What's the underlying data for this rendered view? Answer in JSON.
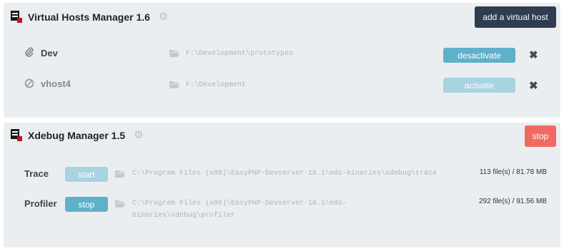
{
  "virtual_hosts_panel": {
    "title": "Virtual Hosts Manager 1.6",
    "add_button_label": "add a virtual host",
    "hosts": [
      {
        "name": "Dev",
        "path": "F:\\Development\\prototypes",
        "button_label": "desactivate",
        "status": "active"
      },
      {
        "name": "vhost4",
        "path": "F:\\Development",
        "button_label": "activate",
        "status": "inactive"
      }
    ]
  },
  "xdebug_panel": {
    "title": "Xdebug Manager 1.5",
    "stop_button_label": "stop",
    "rows": [
      {
        "name": "Trace",
        "button_label": "start",
        "path": "C:\\Program Files (x86)\\EasyPHP-Devserver-16.1\\eds-binaries\\xdebug\\trace",
        "size": "113 file(s) / 81.78 MB"
      },
      {
        "name": "Profiler",
        "button_label": "stop",
        "path_line1": "C:\\Program Files (x86)\\EasyPHP-Devserver-16.1\\eds-",
        "path_line2": "binaries\\xdebug\\profiler",
        "size": "292 file(s) / 91.56 MB"
      }
    ]
  },
  "colors": {
    "panel_bg": "#ebeef0",
    "dark_button": "#2e3d4f",
    "teal_button": "#5fb1c9",
    "light_teal_button": "#a8d3e0",
    "red_button": "#f06a63"
  },
  "icons": [
    "app-logo-icon",
    "gear-icon",
    "paperclip-icon",
    "ban-icon",
    "folder-icon",
    "close-icon"
  ]
}
